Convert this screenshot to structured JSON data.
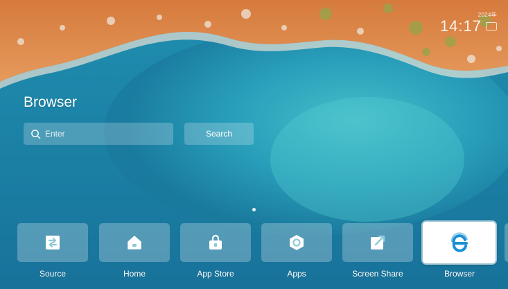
{
  "status": {
    "date": "2024年",
    "time": "14:17"
  },
  "browser": {
    "title": "Browser",
    "search_placeholder": "Enter",
    "search_button": "Search"
  },
  "dock": {
    "items": [
      {
        "label": "Source",
        "icon": "source-icon"
      },
      {
        "label": "Home",
        "icon": "home-icon"
      },
      {
        "label": "App Store",
        "icon": "app-store-icon"
      },
      {
        "label": "Apps",
        "icon": "apps-icon"
      },
      {
        "label": "Screen Share",
        "icon": "screen-share-icon"
      },
      {
        "label": "Browser",
        "icon": "browser-icon",
        "selected": true
      }
    ]
  },
  "colors": {
    "sea": "#1e86a6",
    "shore": "#d9824a",
    "tile": "rgba(255,255,255,0.26)",
    "browser_accent": "#1a8fd8"
  }
}
